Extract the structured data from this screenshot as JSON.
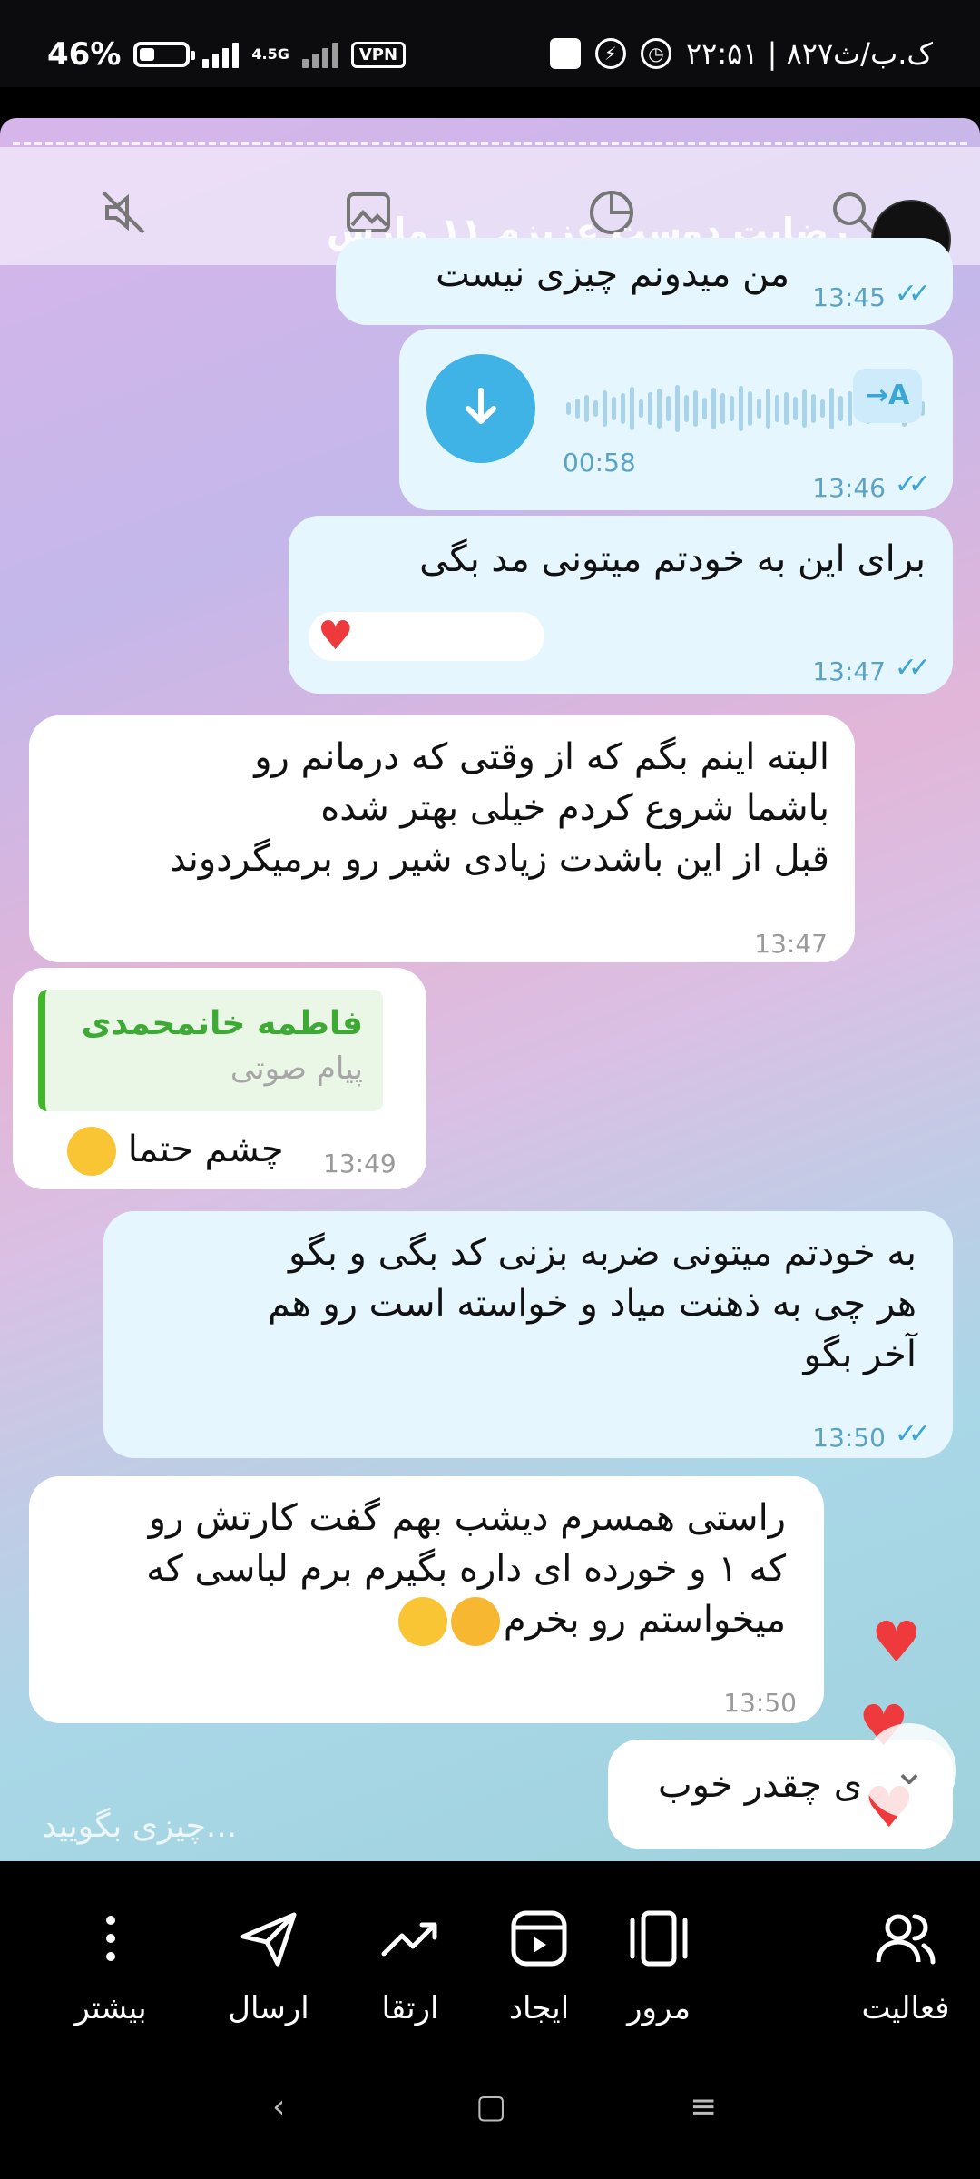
{
  "status_bar": {
    "battery": "46%",
    "battery_level": 0.46,
    "network": "4.5G",
    "vpn": "VPN",
    "time_speed": "۲۲:۵۱ | ۸۲۷ک.ب/ث"
  },
  "chat": {
    "title": "رضایت دوست عزیزم ۱۱ مارس",
    "messages": [
      {
        "text": "من میدونم چیزی نیست",
        "time": "13:45"
      },
      {
        "duration": "00:58",
        "transcribe": "A",
        "time": "13:46"
      },
      {
        "text": "برای این به خودتم میتونی مد بگی",
        "time": "13:47"
      },
      {
        "lines": [
          "البته اینم بگم که از وقتی که درمانم رو",
          "باشما شروع کردم خیلی بهتر شده",
          "قبل از این باشدت زیادی شیر رو برمیگردوند"
        ],
        "time": "13:47"
      },
      {
        "reply_name": "فاطمه خانمحمدی",
        "reply_type": "پیام صوتی",
        "text": "چشم حتما",
        "time": "13:49"
      },
      {
        "lines": [
          "به خودتم میتونی ضربه بزنی کد بگی و بگو",
          "هر چی به ذهنت میاد و خواسته است رو هم",
          "آخر بگو"
        ],
        "time": "13:50"
      },
      {
        "lines": [
          "راستی همسرم دیشب بهم گفت کارتش رو",
          "که ۱ و خورده ای داره بگیرم برم لباسی که",
          "میخواستم رو بخرم"
        ],
        "time": "13:50"
      },
      {
        "text": "ی چقدر خوب"
      }
    ],
    "input_placeholder": "چیزی بگویید..."
  },
  "bottom_nav": {
    "more": "بیشتر",
    "send": "ارسال",
    "promote": "ارتقا",
    "create": "ایجاد",
    "browse": "مرور",
    "activity": "فعالیت"
  },
  "colors": {
    "outgoing_bubble": "#e6f6ff",
    "incoming_bubble": "#ffffff",
    "accent": "#3fb3e6",
    "reply_green": "#43b52a",
    "heart": "#ee3a3d"
  }
}
